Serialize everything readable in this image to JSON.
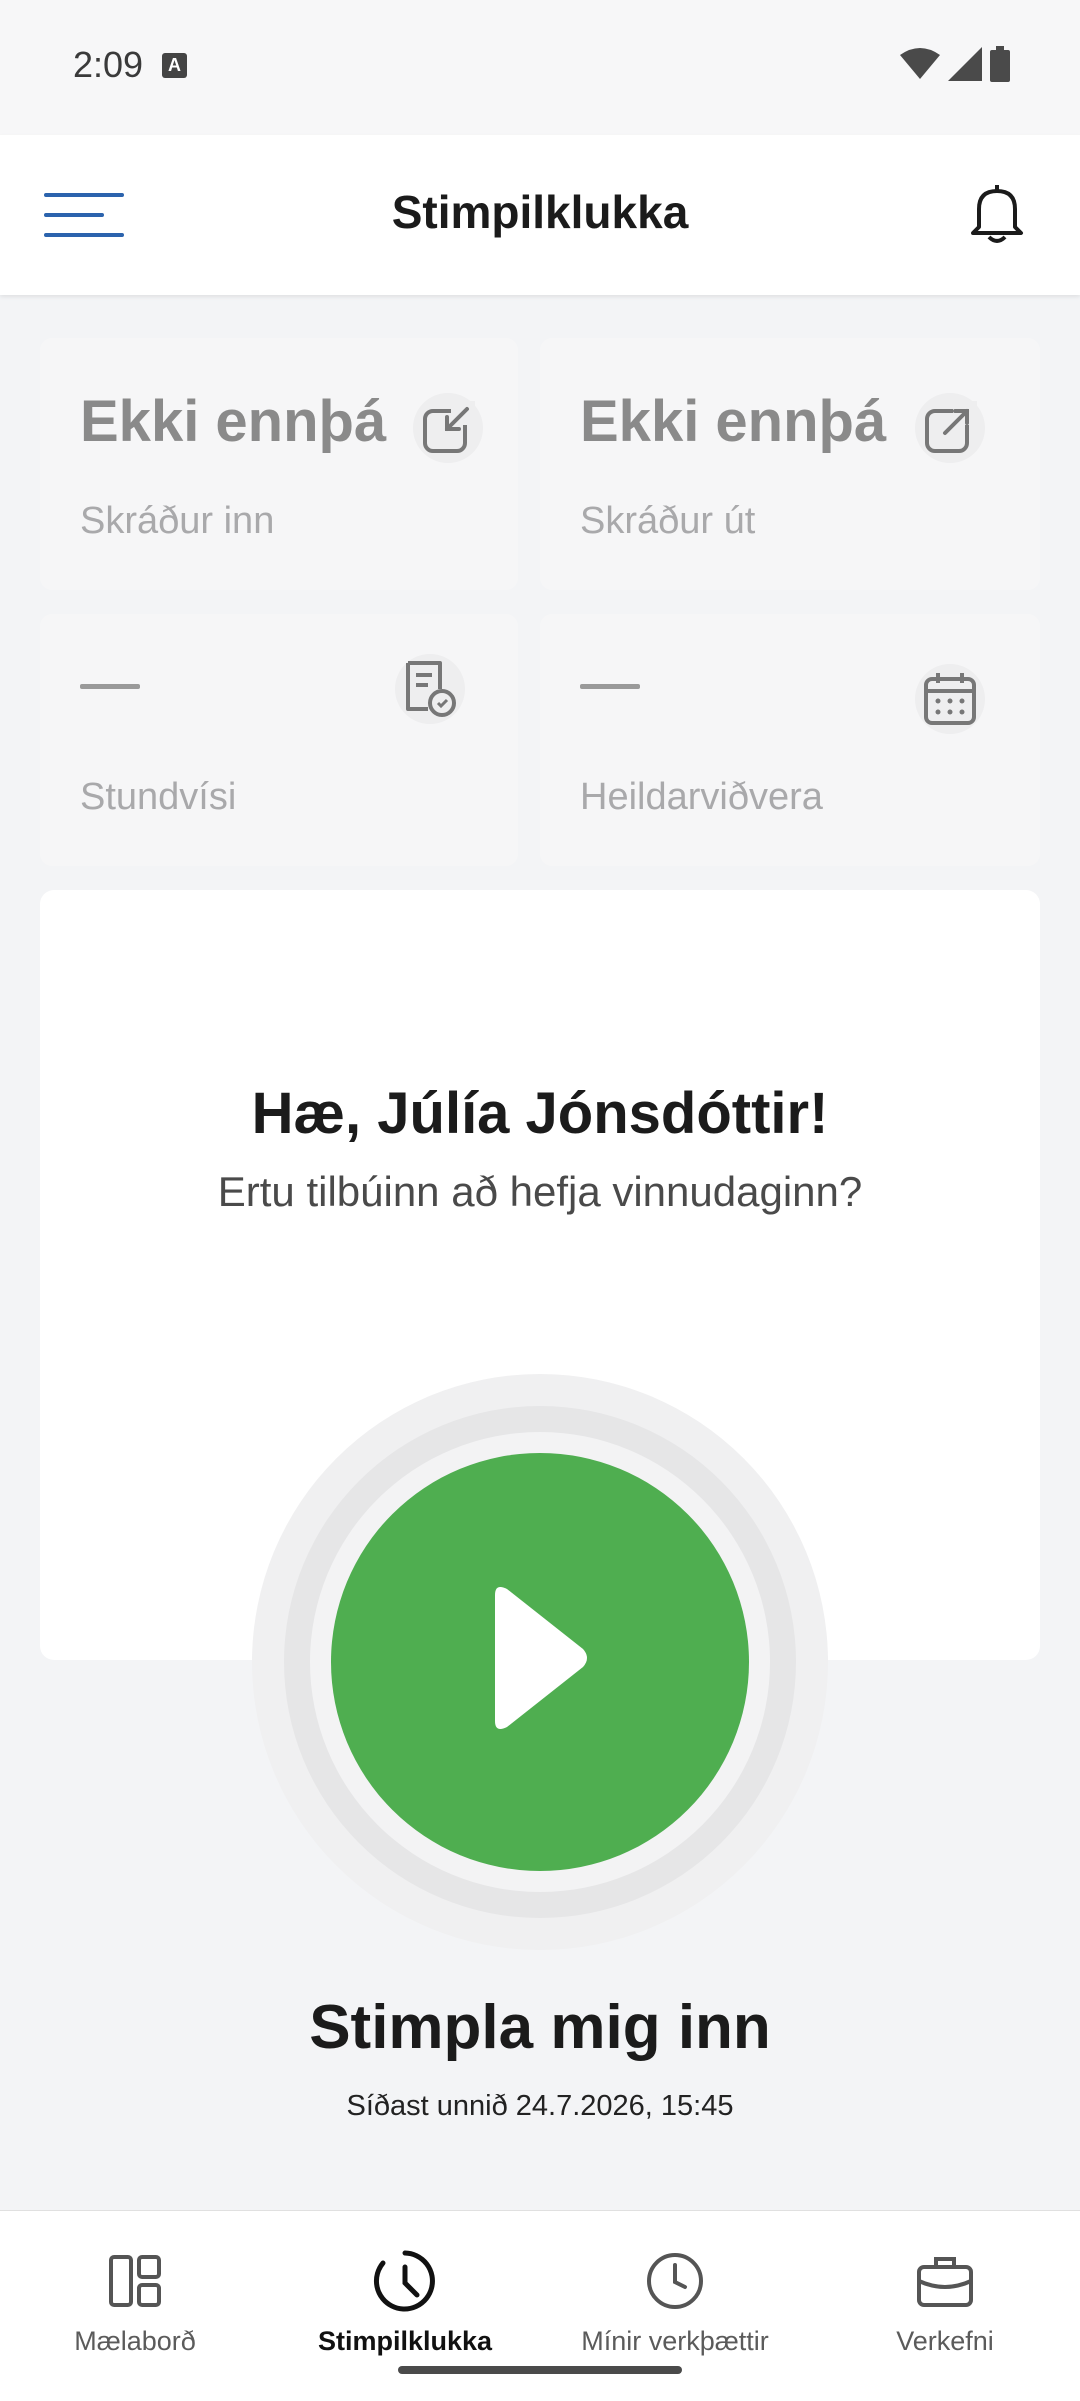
{
  "status_bar": {
    "time": "2:09",
    "indicator": "A",
    "icons": [
      "wifi-icon",
      "signal-icon",
      "battery-icon"
    ]
  },
  "app_bar": {
    "title": "Stimpilklukka",
    "menu_icon": "menu-icon",
    "notification_icon": "bell-icon"
  },
  "stats": {
    "clock_in": {
      "value": "Ekki ennþá",
      "label": "Skráður inn",
      "icon": "arrow-in-icon"
    },
    "clock_out": {
      "value": "Ekki ennþá",
      "label": "Skráður út",
      "icon": "arrow-out-icon"
    },
    "punctuality": {
      "value": "",
      "label": "Stundvísi",
      "icon": "document-clock-icon"
    },
    "total_presence": {
      "value": "",
      "label": "Heildarviðvera",
      "icon": "calendar-icon"
    }
  },
  "welcome": {
    "greeting": "Hæ, Júlía Jónsdóttir!",
    "subtitle": "Ertu tilbúinn að hefja vinnudaginn?"
  },
  "clock_action": {
    "label": "Stimpla mig inn",
    "last_worked": "Síðast unnið 24.7.2026, 15:45",
    "button_color": "#4fae50"
  },
  "bottom_nav": {
    "items": [
      {
        "label": "Mælaborð",
        "icon": "dashboard-icon",
        "active": false
      },
      {
        "label": "Stimpilklukka",
        "icon": "clock-icon",
        "active": true
      },
      {
        "label": "Mínir verkþættir",
        "icon": "clock-outline-icon",
        "active": false
      },
      {
        "label": "Verkefni",
        "icon": "briefcase-icon",
        "active": false
      }
    ]
  },
  "colors": {
    "accent": "#2b63ad",
    "background": "#f3f4f6",
    "primary_green": "#4fae50"
  }
}
